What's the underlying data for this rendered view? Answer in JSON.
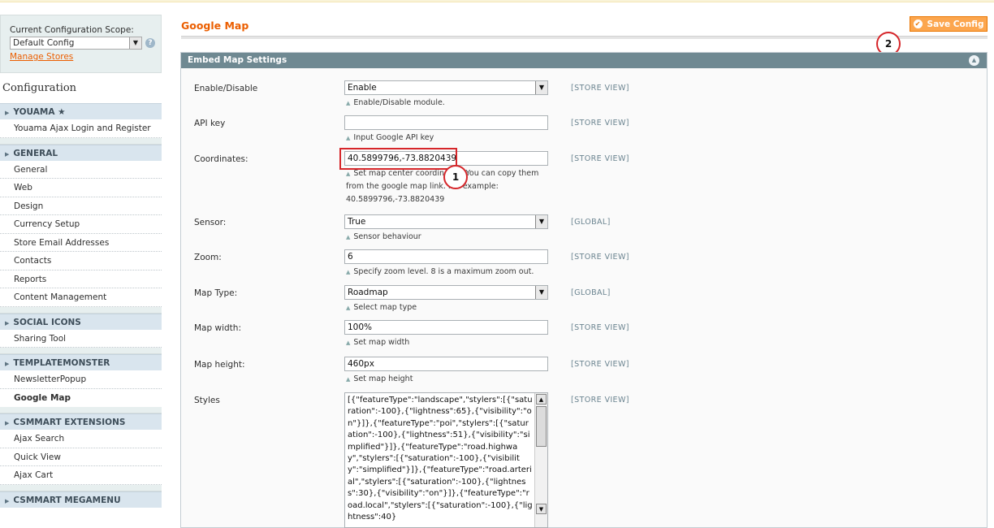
{
  "sidebar": {
    "scope_label": "Current Configuration Scope:",
    "scope_value": "Default Config",
    "manage_stores": "Manage Stores",
    "config_title": "Configuration",
    "sections": [
      {
        "title": "YOUAMA ★",
        "items": [
          "Youama Ajax Login and Register"
        ]
      },
      {
        "title": "GENERAL",
        "items": [
          "General",
          "Web",
          "Design",
          "Currency Setup",
          "Store Email Addresses",
          "Contacts",
          "Reports",
          "Content Management"
        ]
      },
      {
        "title": "SOCIAL ICONS",
        "items": [
          "Sharing Tool"
        ]
      },
      {
        "title": "TEMPLATEMONSTER",
        "items": [
          "NewsletterPopup",
          "Google Map"
        ]
      },
      {
        "title": "CSMMART EXTENSIONS",
        "items": [
          "Ajax Search",
          "Quick View",
          "Ajax Cart"
        ]
      },
      {
        "title": "CSMMART MEGAMENU",
        "items": []
      }
    ],
    "active_item": "Google Map"
  },
  "header": {
    "title": "Google Map",
    "save_label": "Save Config"
  },
  "callouts": {
    "one": "1",
    "two": "2"
  },
  "fieldset": {
    "title": "Embed Map Settings",
    "fields": {
      "enable": {
        "label": "Enable/Disable",
        "value": "Enable",
        "note": "Enable/Disable module.",
        "scope": "[STORE VIEW]"
      },
      "api": {
        "label": "API key",
        "value": "",
        "note": "Input Google API key",
        "scope": "[STORE VIEW]"
      },
      "coords": {
        "label": "Coordinates:",
        "value": "40.5899796,-73.8820439",
        "note1": "Set map center coordinates. You can copy them",
        "note2": "from the google map link. For example:",
        "note3": "40.5899796,-73.8820439",
        "scope": "[STORE VIEW]"
      },
      "sensor": {
        "label": "Sensor:",
        "value": "True",
        "note": "Sensor behaviour",
        "scope": "[GLOBAL]"
      },
      "zoom": {
        "label": "Zoom:",
        "value": "6",
        "note": "Specify zoom level. 8 is a maximum zoom out.",
        "scope": "[STORE VIEW]"
      },
      "maptype": {
        "label": "Map Type:",
        "value": "Roadmap",
        "note": "Select map type",
        "scope": "[GLOBAL]"
      },
      "width": {
        "label": "Map width:",
        "value": "100%",
        "note": "Set map width",
        "scope": "[STORE VIEW]"
      },
      "height": {
        "label": "Map height:",
        "value": "460px",
        "note": "Set map height",
        "scope": "[STORE VIEW]"
      },
      "styles": {
        "label": "Styles",
        "value": "[{\"featureType\":\"landscape\",\"stylers\":[{\"saturation\":-100},{\"lightness\":65},{\"visibility\":\"on\"}]},{\"featureType\":\"poi\",\"stylers\":[{\"saturation\":-100},{\"lightness\":51},{\"visibility\":\"simplified\"}]},{\"featureType\":\"road.highway\",\"stylers\":[{\"saturation\":-100},{\"visibility\":\"simplified\"}]},{\"featureType\":\"road.arterial\",\"stylers\":[{\"saturation\":-100},{\"lightness\":30},{\"visibility\":\"on\"}]},{\"featureType\":\"road.local\",\"stylers\":[{\"saturation\":-100},{\"lightness\":40}",
        "scope": "[STORE VIEW]"
      }
    }
  }
}
